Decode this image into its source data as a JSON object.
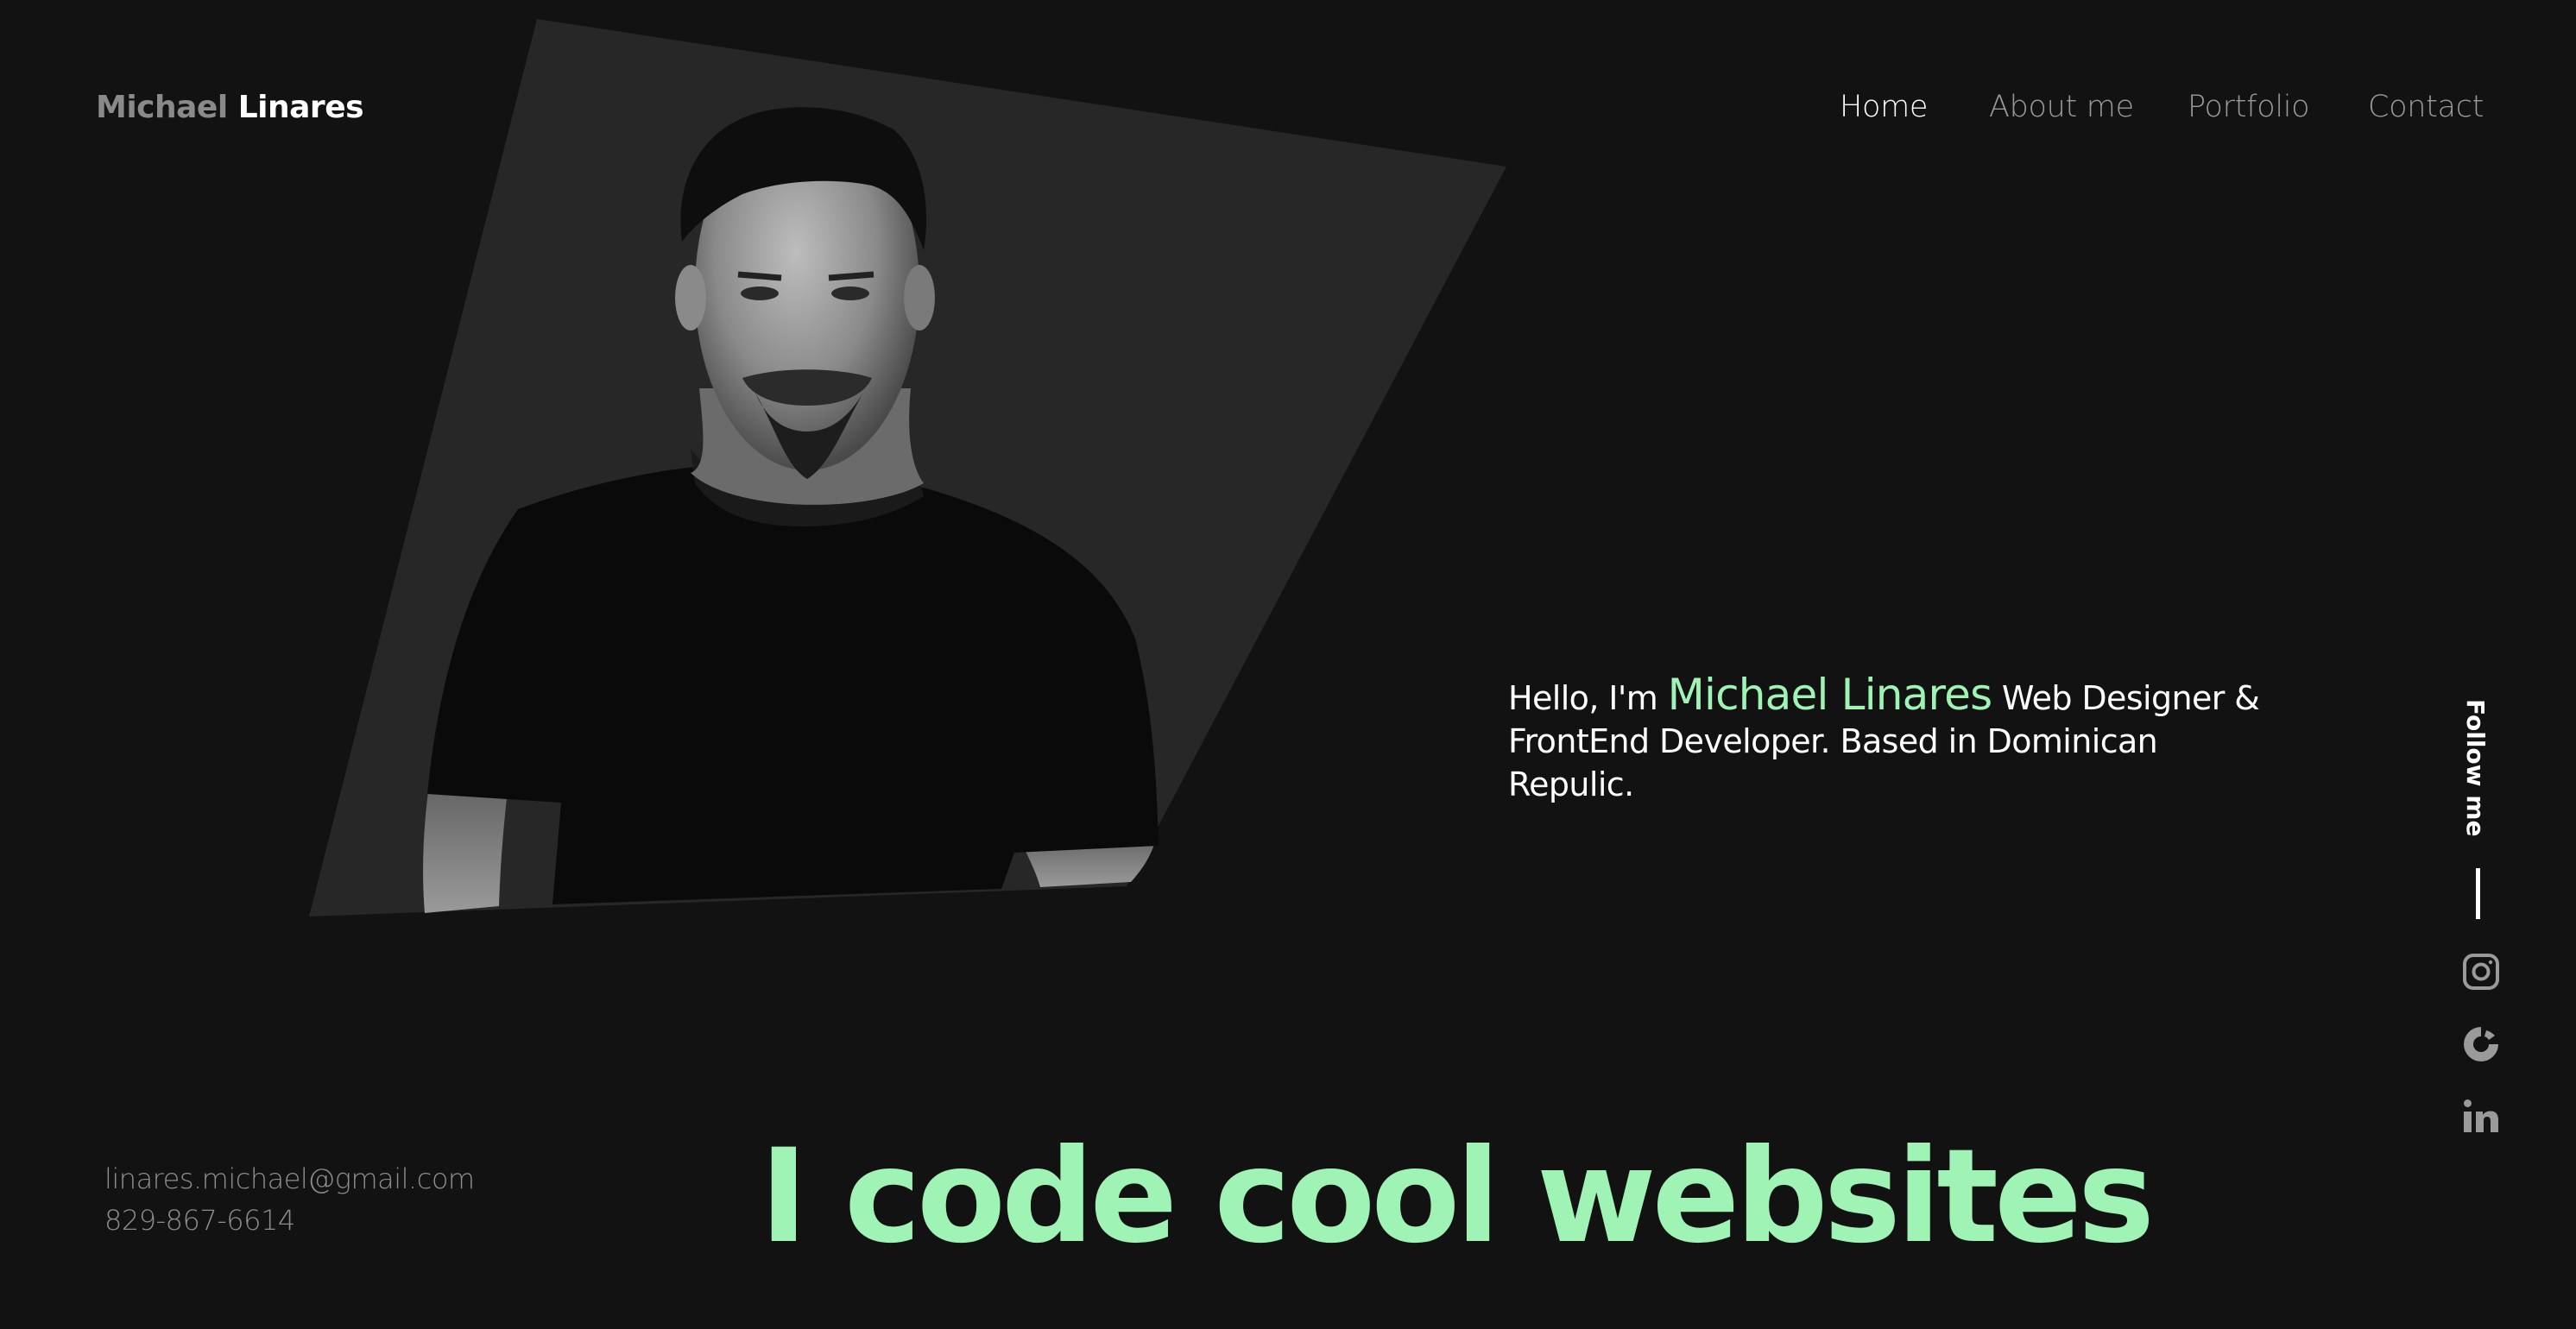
{
  "header": {
    "logo_first": "Michael",
    "logo_last": "Linares",
    "nav": [
      "Home",
      "About me",
      "Portfolio",
      "Contact"
    ],
    "active_nav": "Home"
  },
  "hero": {
    "intro_prefix": "Hello, I'm",
    "intro_name": "Michael Linares",
    "intro_suffix_1": "Web Designer &",
    "intro_line_2": "FrontEnd Developer. Based in Dominican Repulic.",
    "tagline": "I code cool websites"
  },
  "follow": {
    "label": "Follow me",
    "icons": [
      "instagram-icon",
      "codepen-icon",
      "linkedin-icon"
    ]
  },
  "contact": {
    "email": "linares.michael@gmail.com",
    "phone": "829-867-6614"
  },
  "colors": {
    "background": "#121212",
    "panel": "#272727",
    "accent": "#9ef3b5",
    "muted": "#8d8d8d"
  }
}
